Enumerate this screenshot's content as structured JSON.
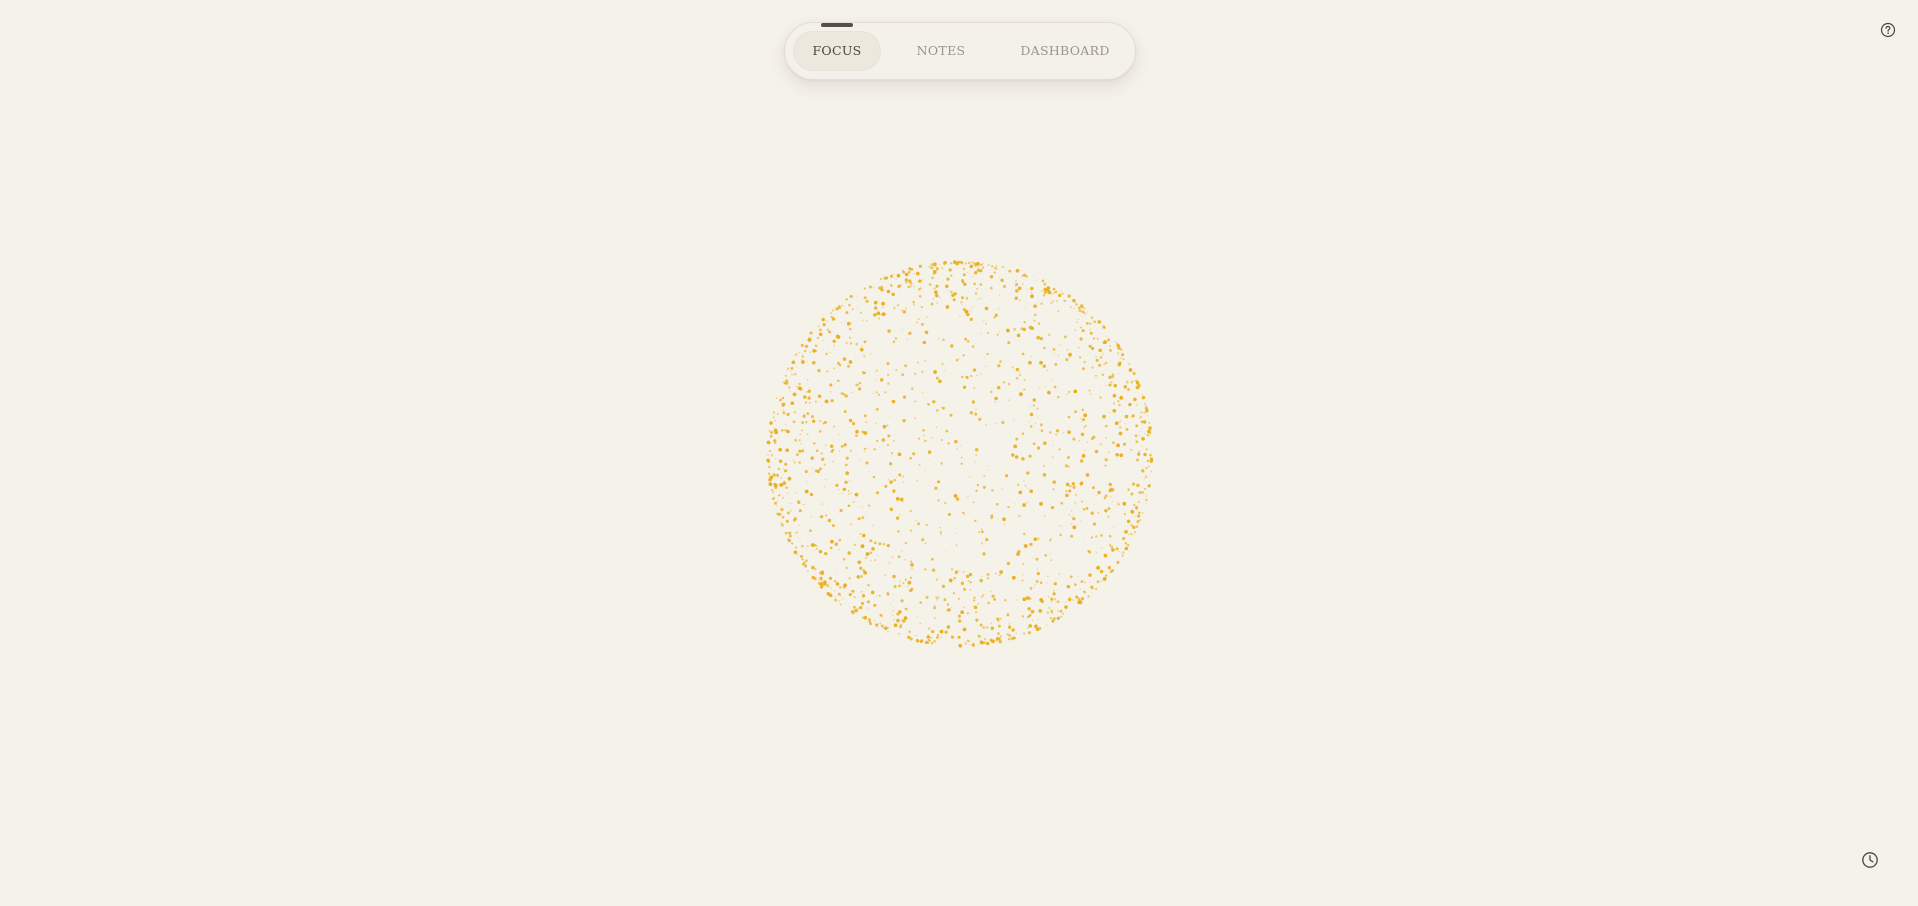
{
  "nav": {
    "tabs": [
      {
        "label": "FOCUS",
        "active": true
      },
      {
        "label": "NOTES",
        "active": false
      },
      {
        "label": "DASHBOARD",
        "active": false
      }
    ]
  },
  "icons": {
    "help": "help-circle-icon",
    "history": "clock-icon"
  },
  "orb": {
    "color": "#e8b020",
    "background": "#f5f2ea"
  }
}
